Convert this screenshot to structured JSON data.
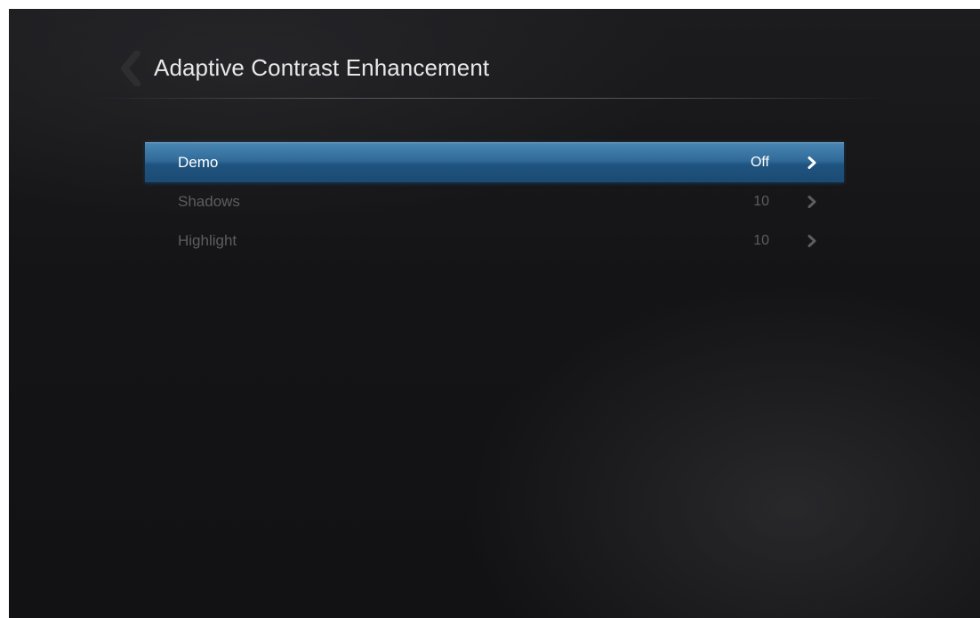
{
  "header": {
    "title": "Adaptive Contrast Enhancement",
    "back_icon": "chevron-left-icon"
  },
  "colors": {
    "selection_top": "#4a86b3",
    "selection_bottom": "#1b4a72",
    "selected_text": "#ffffff",
    "dim_text": "#5d5d60",
    "background": "#141416"
  },
  "menu": {
    "selected_index": 0,
    "items": [
      {
        "label": "Demo",
        "value": "Off",
        "icon": "chevron-right-icon"
      },
      {
        "label": "Shadows",
        "value": "10",
        "icon": "chevron-right-icon"
      },
      {
        "label": "Highlight",
        "value": "10",
        "icon": "chevron-right-icon"
      }
    ]
  }
}
